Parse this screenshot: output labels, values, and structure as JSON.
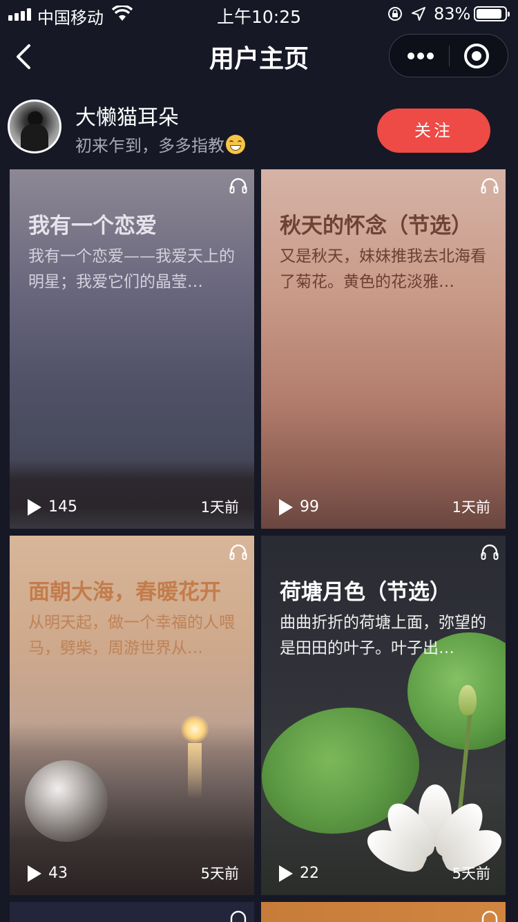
{
  "status_bar": {
    "carrier": "中国移动",
    "time": "上午10:25",
    "battery_percent": "83%",
    "battery_level": 0.83
  },
  "navbar": {
    "title": "用户主页",
    "icons": [
      "back-chevron-icon",
      "more-dots-icon",
      "target-icon"
    ]
  },
  "profile": {
    "name": "大懒猫耳朵",
    "bio": "初来乍到，多多指教",
    "bio_emoji": "grinning-face-icon",
    "follow_label": "关注",
    "follow_color": "#ee4a46"
  },
  "posts": [
    {
      "title": "我有一个恋爱",
      "excerpt": "我有一个恋爱——我爱天上的明星；我爱它们的晶莹…",
      "plays": "145",
      "time": "1天前"
    },
    {
      "title": "秋天的怀念（节选）",
      "excerpt": "又是秋天，妹妹推我去北海看了菊花。黄色的花淡雅…",
      "plays": "99",
      "time": "1天前"
    },
    {
      "title": "面朝大海，春暖花开",
      "excerpt": "从明天起，做一个幸福的人喂马，劈柴，周游世界从…",
      "plays": "43",
      "time": "5天前"
    },
    {
      "title": "荷塘月色（节选）",
      "excerpt": "曲曲折折的荷塘上面，弥望的是田田的叶子。叶子出…",
      "plays": "22",
      "time": "5天前"
    }
  ],
  "colors": {
    "background": "#161826",
    "accent": "#ee4a46"
  }
}
